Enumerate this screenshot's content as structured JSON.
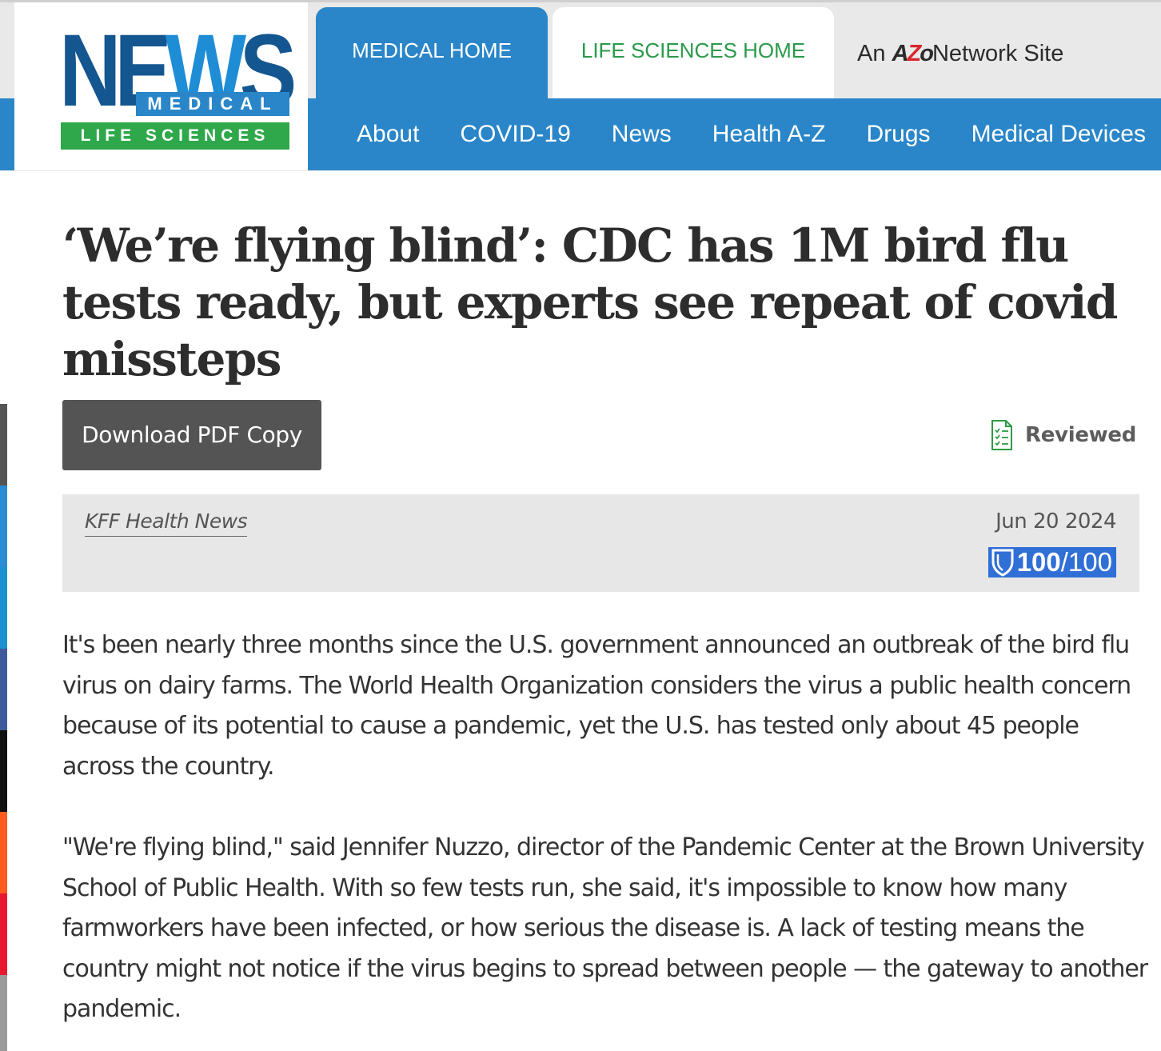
{
  "header": {
    "logo": {
      "news_prefix": "NE",
      "news_w": "W",
      "news_suffix": "S",
      "medical": "MEDICAL",
      "life_sciences": "LIFE SCIENCES"
    },
    "tabs": [
      {
        "label": "MEDICAL HOME"
      },
      {
        "label": "LIFE SCIENCES HOME"
      }
    ],
    "network": {
      "prefix": "An",
      "azo_a": "A",
      "azo_z": "Z",
      "azo_o": "o",
      "network_word": "Network",
      "suffix": "Site"
    },
    "nav": [
      {
        "label": "About"
      },
      {
        "label": "COVID-19"
      },
      {
        "label": "News"
      },
      {
        "label": "Health A-Z"
      },
      {
        "label": "Drugs"
      },
      {
        "label": "Medical Devices"
      }
    ]
  },
  "article": {
    "title": "‘We’re flying blind’: CDC has 1M bird flu tests ready, but experts see repeat of covid missteps",
    "download_label": "Download PDF Copy",
    "reviewed_label": "Reviewed",
    "source": "KFF Health News",
    "date": "Jun 20 2024",
    "score": {
      "value": "100",
      "suffix": "/100"
    },
    "paragraphs": [
      "It's been nearly three months since the U.S. government announced an outbreak of the bird flu virus on dairy farms. The World Health Organization considers the virus a public health concern because of its potential to cause a pandemic, yet the U.S. has tested only about 45 people across the country.",
      "\"We're flying blind,\" said Jennifer Nuzzo, director of the Pandemic Center at the Brown University School of Public Health. With so few tests run, she said, it's impossible to know how many farmworkers have been infected, or how serious the disease is. A lack of testing means the country might not notice if the virus begins to spread between people — the gateway to another pandemic."
    ]
  },
  "colors": {
    "brand_blue": "#2a86c8",
    "brand_dark_blue": "#14568f",
    "brand_green": "#2ea84a",
    "score_blue": "#2f6fd6",
    "share_rail": [
      "#555555",
      "#2a8bd6",
      "#1b8fcf",
      "#3d5a9c",
      "#111111",
      "#ff5a1f",
      "#e8192f",
      "#9a9a9a"
    ]
  },
  "icons": {
    "reviewed": "checklist-icon",
    "score": "shield-icon"
  }
}
